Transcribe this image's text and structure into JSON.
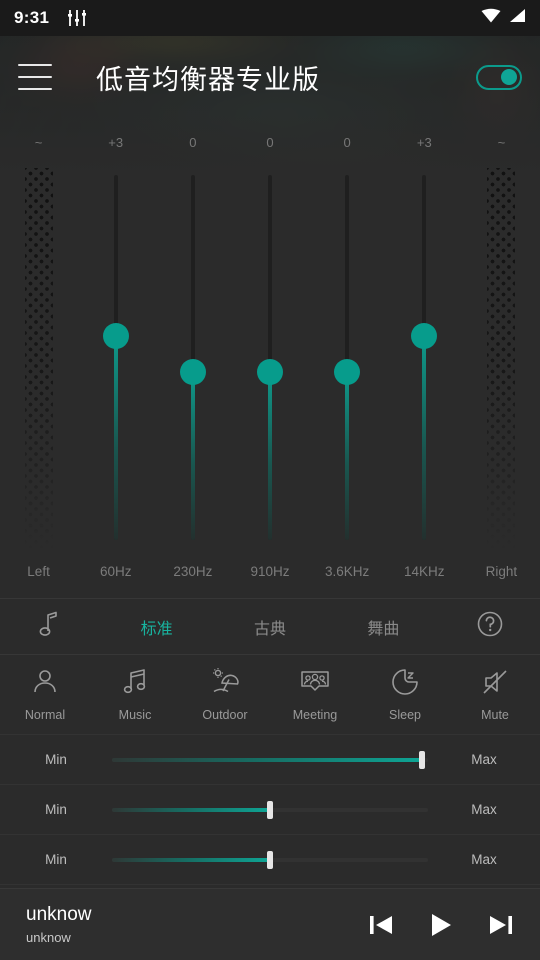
{
  "status_bar": {
    "time": "9:31",
    "eq_icon": "equalizer-icon",
    "wifi_icon": "wifi-icon",
    "signal_icon": "cell-signal-icon"
  },
  "app_bar": {
    "menu_icon": "hamburger-menu-icon",
    "title": "低音均衡器专业版",
    "power_toggle": {
      "state": "on",
      "accent": "#0fa596"
    }
  },
  "equalizer": {
    "columns": [
      {
        "top_label": "~",
        "bottom_label": "Left",
        "type": "grille"
      },
      {
        "top_label": "+3",
        "bottom_label": "60Hz",
        "type": "slider",
        "value_pct": 56
      },
      {
        "top_label": "0",
        "bottom_label": "230Hz",
        "type": "slider",
        "value_pct": 46
      },
      {
        "top_label": "0",
        "bottom_label": "910Hz",
        "type": "slider",
        "value_pct": 46
      },
      {
        "top_label": "0",
        "bottom_label": "3.6KHz",
        "type": "slider",
        "value_pct": 46
      },
      {
        "top_label": "+3",
        "bottom_label": "14KHz",
        "type": "slider",
        "value_pct": 56
      },
      {
        "top_label": "~",
        "bottom_label": "Right",
        "type": "grille"
      }
    ]
  },
  "presets": {
    "accent": "#18b39f",
    "items": [
      {
        "label": "",
        "icon": "music-note-icon",
        "active": false
      },
      {
        "label": "标准",
        "icon": "",
        "active": true
      },
      {
        "label": "古典",
        "icon": "",
        "active": false
      },
      {
        "label": "舞曲",
        "icon": "",
        "active": false
      },
      {
        "label": "",
        "icon": "help-circle-icon",
        "active": false
      }
    ]
  },
  "modes": [
    {
      "label": "Normal",
      "icon": "person-icon"
    },
    {
      "label": "Music",
      "icon": "music-notes-icon"
    },
    {
      "label": "Outdoor",
      "icon": "beach-umbrella-icon"
    },
    {
      "label": "Meeting",
      "icon": "meeting-people-icon"
    },
    {
      "label": "Sleep",
      "icon": "moon-sleep-icon"
    },
    {
      "label": "Mute",
      "icon": "speaker-mute-icon"
    }
  ],
  "level_sliders": [
    {
      "min_label": "Min",
      "max_label": "Max",
      "value_pct": 98
    },
    {
      "min_label": "Min",
      "max_label": "Max",
      "value_pct": 50
    },
    {
      "min_label": "Min",
      "max_label": "Max",
      "value_pct": 50
    }
  ],
  "player": {
    "title": "unknow",
    "subtitle": "unknow",
    "prev_icon": "skip-previous-icon",
    "play_icon": "play-icon",
    "next_icon": "skip-next-icon"
  }
}
